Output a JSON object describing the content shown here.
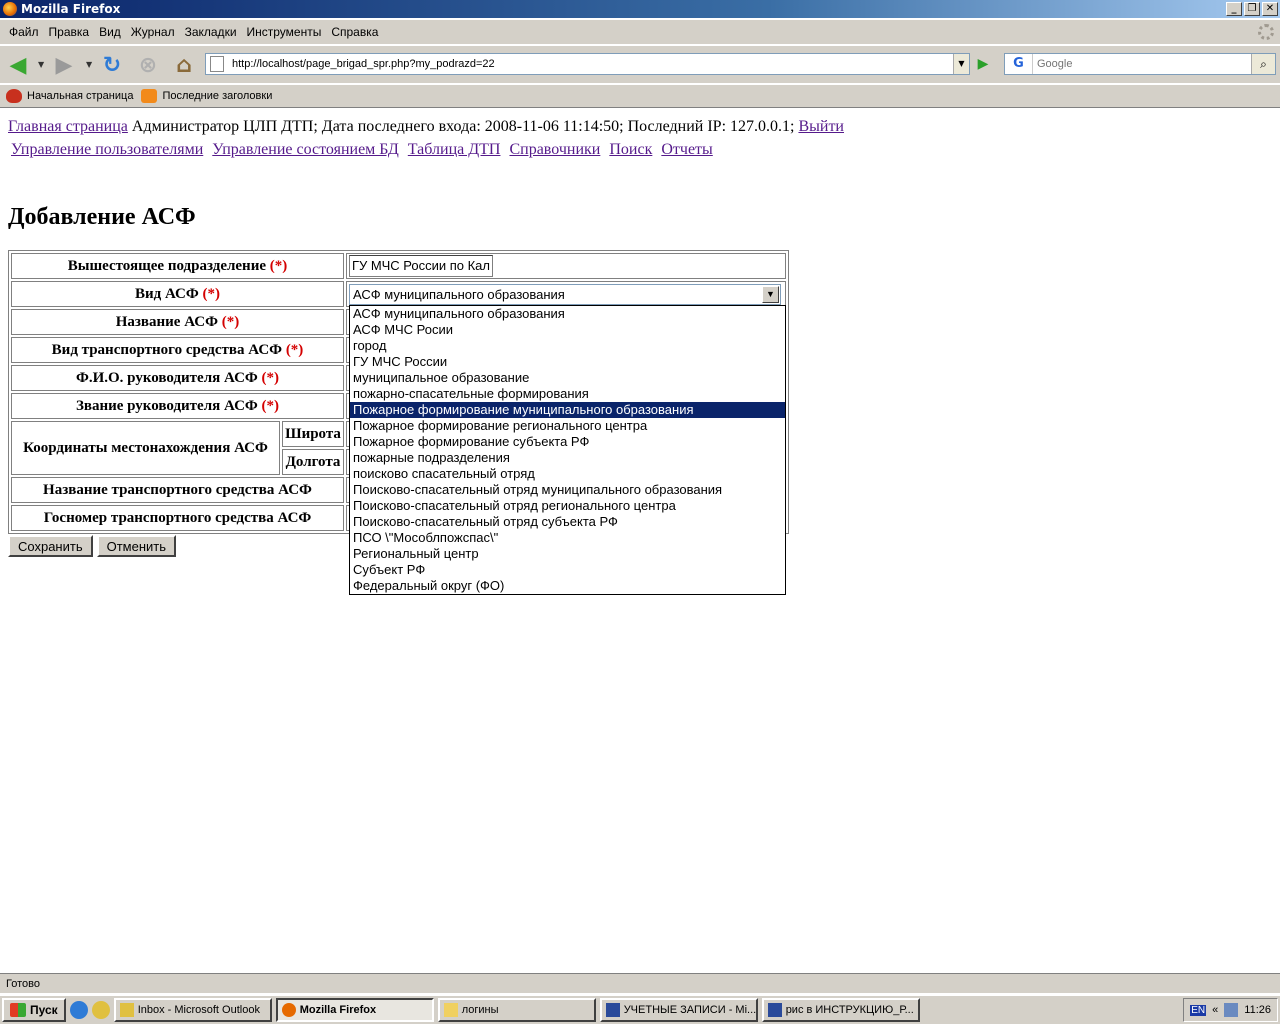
{
  "window": {
    "title": "Mozilla Firefox"
  },
  "menu": [
    "Файл",
    "Правка",
    "Вид",
    "Журнал",
    "Закладки",
    "Инструменты",
    "Справка"
  ],
  "navigation": {
    "url": "http://localhost/page_brigad_spr.php?my_podrazd=22",
    "search_placeholder": "Google"
  },
  "bookmarks": [
    {
      "label": "Начальная страница",
      "icon": "firefox-start-icon"
    },
    {
      "label": "Последние заголовки",
      "icon": "rss-icon"
    }
  ],
  "header": {
    "home_link": "Главная страница",
    "info": "Администратор ЦЛП ДТП; Дата последнего входа: 2008-11-06 11:14:50; Последний IP: 127.0.0.1;",
    "logout_link": "Выйти",
    "nav_links": [
      "Управление пользователями",
      "Управление состоянием БД",
      "Таблица ДТП",
      "Справочники",
      "Поиск",
      "Отчеты"
    ]
  },
  "page": {
    "title": "Добавление АСФ"
  },
  "form": {
    "required_mark": "(*)",
    "parent_unit_label": "Вышестоящее подразделение",
    "parent_unit_value": "ГУ МЧС России по Кал",
    "type_label": "Вид АСФ",
    "type_value": "АСФ муниципального образования",
    "name_label": "Название АСФ",
    "vehicle_type_label": "Вид транспортного средства АСФ",
    "leader_name_label": "Ф.И.О. руководителя АСФ",
    "leader_rank_label": "Звание руководителя АСФ",
    "coords_label": "Координаты местонахождения АСФ",
    "lat_label": "Широта",
    "lon_label": "Долгота",
    "vehicle_name_label": "Название транспортного средства АСФ",
    "plate_label": "Госномер транспортного средства АСФ",
    "save_button": "Сохранить",
    "cancel_button": "Отменить"
  },
  "dropdown": {
    "selected_index": 6,
    "options": [
      "АСФ муниципального образования",
      "АСФ МЧС Росии",
      "город",
      "ГУ МЧС России",
      "муниципальное образование",
      "пожарно-спасательные формирования",
      "Пожарное формирование муниципального образования",
      "Пожарное формирование регионального центра",
      "Пожарное формирование субъекта РФ",
      "пожарные подразделения",
      "поисково спасательный отряд",
      "Поисково-спасательный отряд муниципального образования",
      "Поисково-спасательный отряд регионального центра",
      "Поисково-спасательный отряд субъекта РФ",
      "ПСО \\\"Мособлпожспас\\\"",
      "Региональный центр",
      "Субъект РФ",
      "Федеральный округ (ФО)"
    ]
  },
  "status": {
    "text": "Готово"
  },
  "taskbar": {
    "start": "Пуск",
    "tasks": [
      {
        "label": "Inbox - Microsoft Outlook",
        "active": false
      },
      {
        "label": "Mozilla Firefox",
        "active": true
      },
      {
        "label": "логины",
        "active": false
      },
      {
        "label": "УЧЕТНЫЕ ЗАПИСИ - Mi...",
        "active": false
      },
      {
        "label": "рис в ИНСТРУКЦИЮ_Р...",
        "active": false
      }
    ],
    "lang": "EN",
    "chevron": "«",
    "clock": "11:26"
  }
}
